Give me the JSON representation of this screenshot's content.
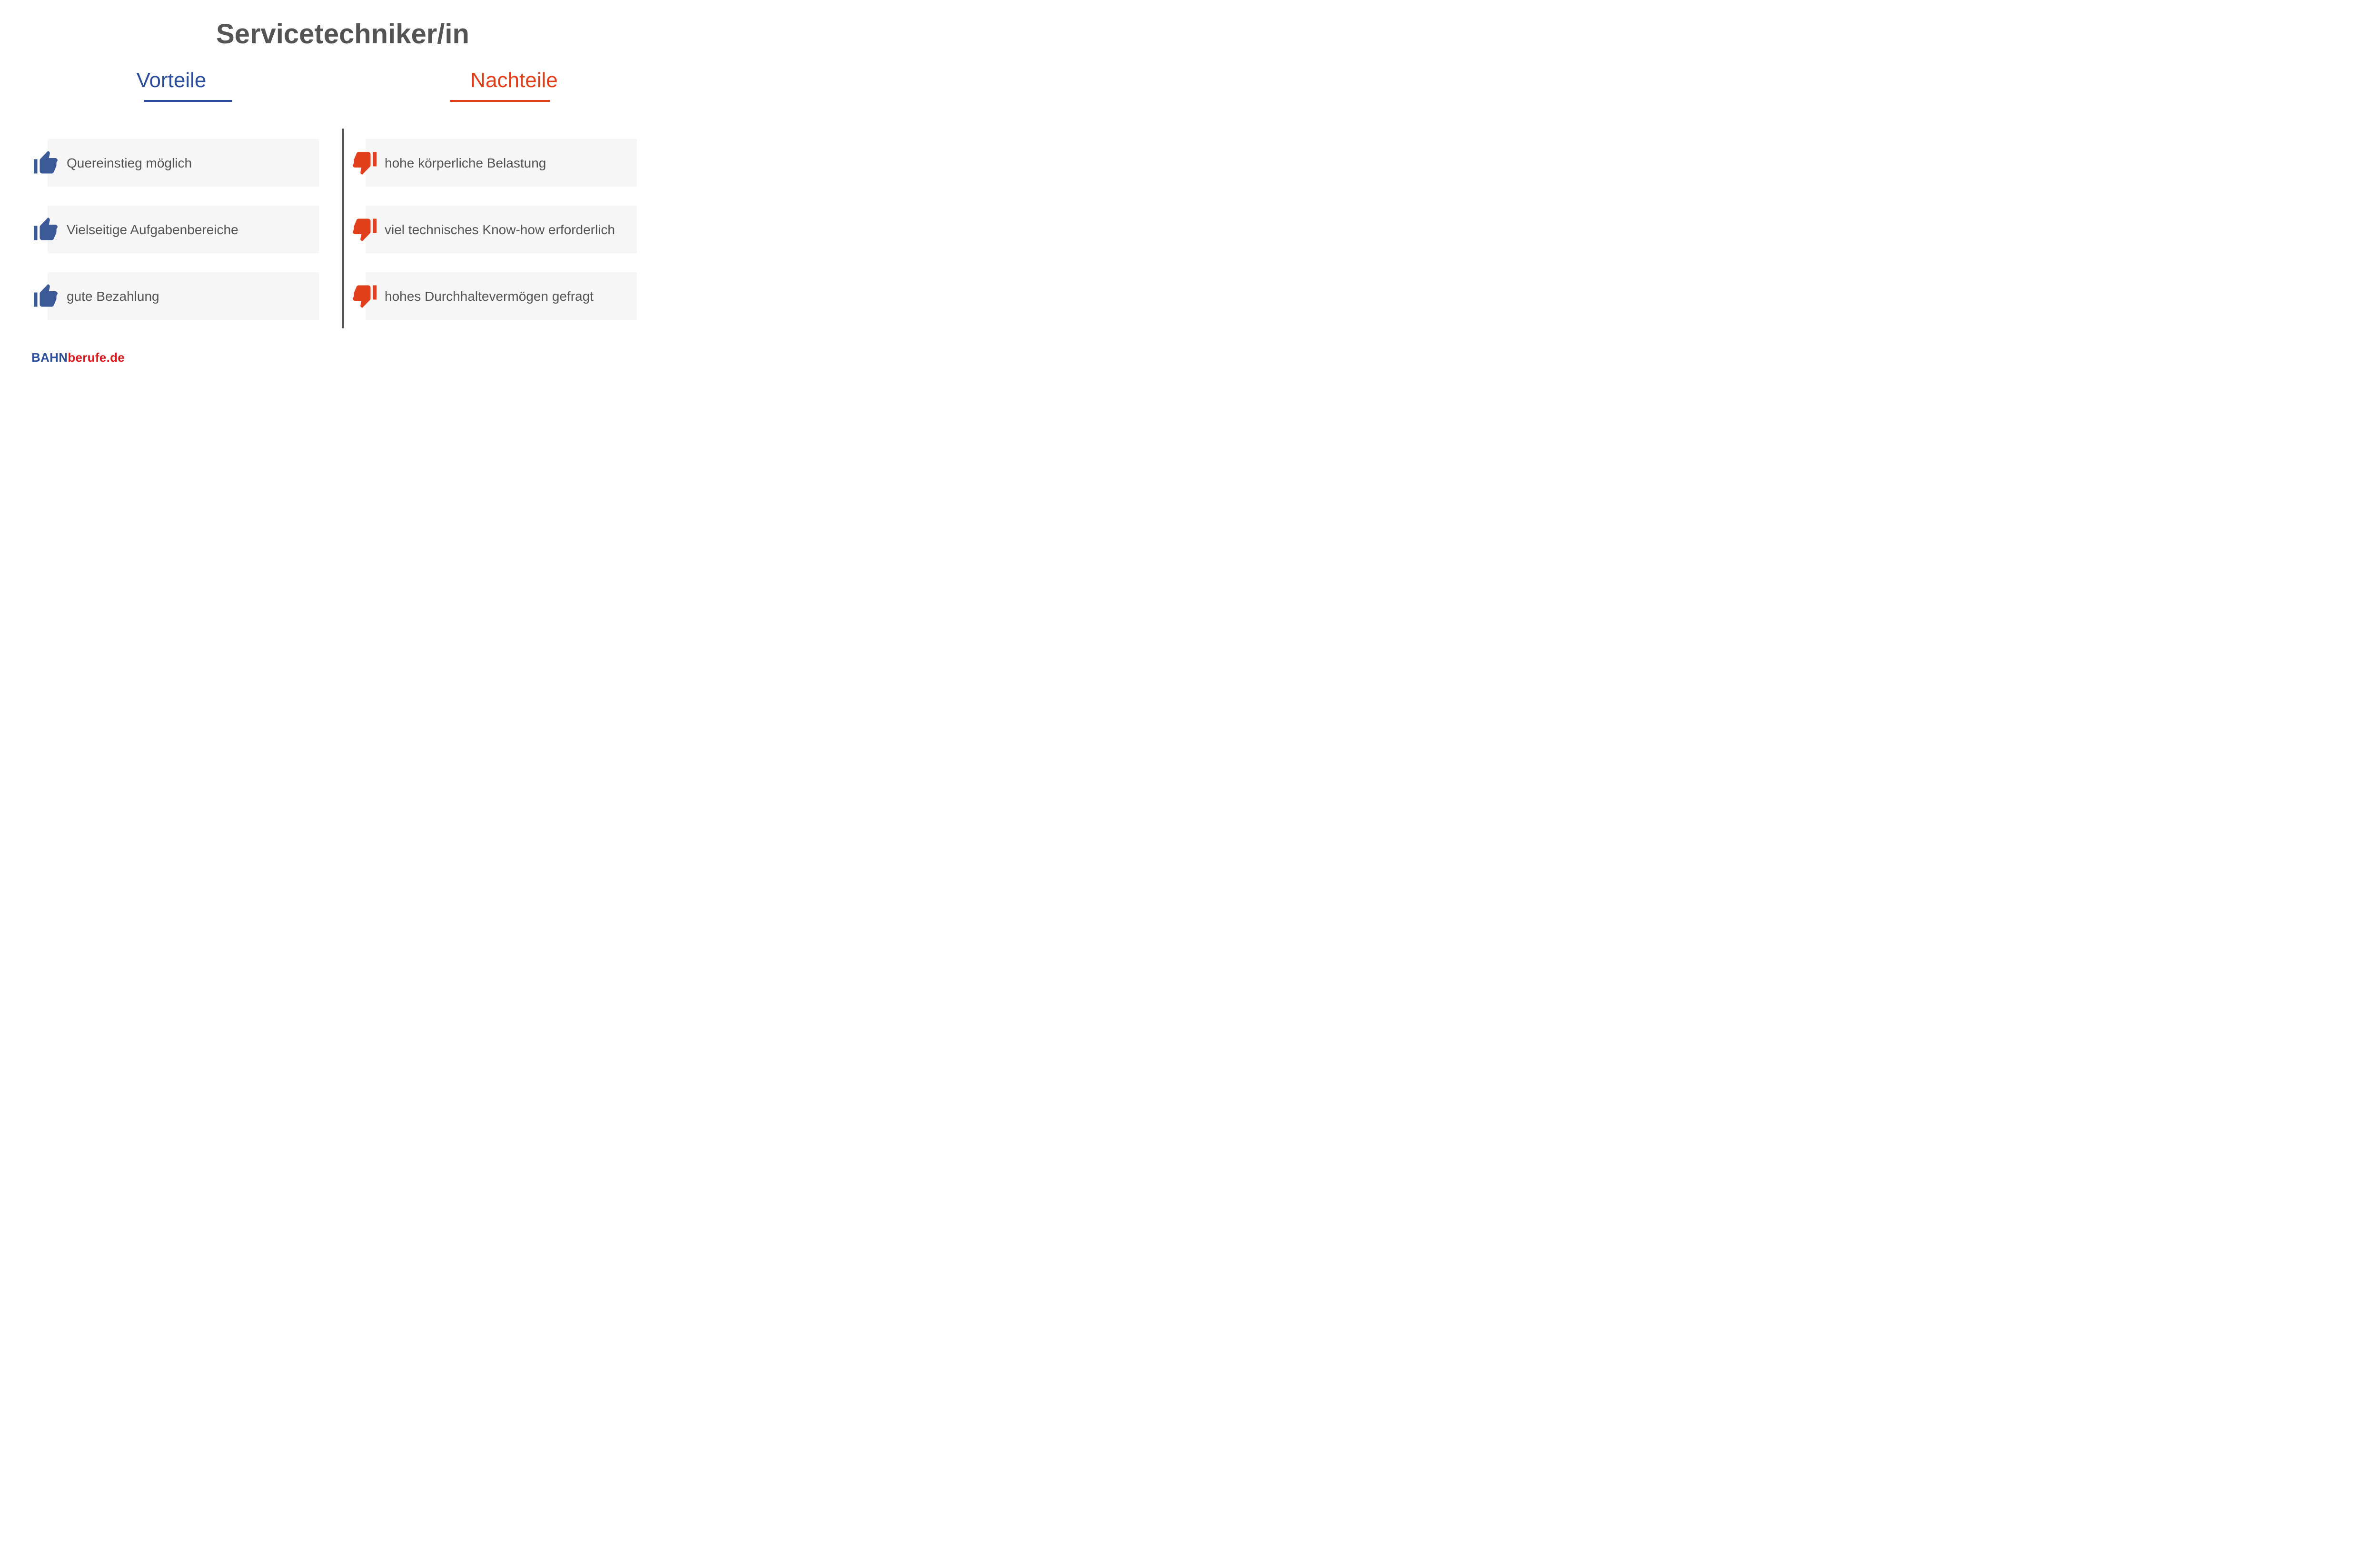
{
  "title": "Servicetechniker/in",
  "left": {
    "heading": "Vorteile",
    "color": "#2d4d9d",
    "items": [
      "Quereinstieg möglich",
      "Vielseitige Aufgabenbereiche",
      "gute Bezahlung"
    ]
  },
  "right": {
    "heading": "Nachteile",
    "color": "#e2401c",
    "items": [
      "hohe körperliche Belastung",
      "viel technisches Know-how erforderlich",
      "hohes Durchhaltevermögen gefragt"
    ]
  },
  "brand": {
    "part1": "BAHN",
    "part2": "berufe.de"
  },
  "icons": {
    "up": "thumb-up-icon",
    "down": "thumb-down-icon"
  }
}
